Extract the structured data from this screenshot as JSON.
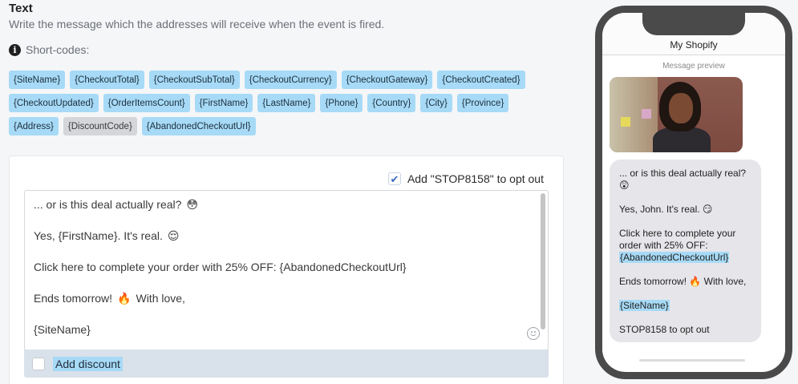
{
  "section": {
    "title": "Text",
    "description": "Write the message which the addresses will receive when the event is fired.",
    "shortcodes_label": "Short-codes:"
  },
  "shortcodes": [
    {
      "label": "{SiteName}",
      "disabled": false
    },
    {
      "label": "{CheckoutTotal}",
      "disabled": false
    },
    {
      "label": "{CheckoutSubTotal}",
      "disabled": false
    },
    {
      "label": "{CheckoutCurrency}",
      "disabled": false
    },
    {
      "label": "{CheckoutGateway}",
      "disabled": false
    },
    {
      "label": "{CheckoutCreated}",
      "disabled": false
    },
    {
      "label": "{CheckoutUpdated}",
      "disabled": false
    },
    {
      "label": "{OrderItemsCount}",
      "disabled": false
    },
    {
      "label": "{FirstName}",
      "disabled": false
    },
    {
      "label": "{LastName}",
      "disabled": false
    },
    {
      "label": "{Phone}",
      "disabled": false
    },
    {
      "label": "{Country}",
      "disabled": false
    },
    {
      "label": "{City}",
      "disabled": false
    },
    {
      "label": "{Province}",
      "disabled": false
    },
    {
      "label": "{Address}",
      "disabled": false
    },
    {
      "label": "{DiscountCode}",
      "disabled": true
    },
    {
      "label": "{AbandonedCheckoutUrl}",
      "disabled": false
    }
  ],
  "editor": {
    "optout_label": "Add \"STOP8158\" to opt out",
    "optout_checked": true,
    "lines": [
      {
        "text": "... or is this deal actually real?",
        "emoji": "😳"
      },
      {
        "text": "Yes, {FirstName}. It's real.",
        "emoji": "😌"
      },
      {
        "text": "Click here to complete your order with 25% OFF: {AbandonedCheckoutUrl}",
        "emoji": ""
      },
      {
        "text": "Ends tomorrow!",
        "emoji": "🔥",
        "after": "With love,"
      },
      {
        "text": "{SiteName}",
        "emoji": ""
      }
    ],
    "add_discount_label": "Add discount"
  },
  "phone": {
    "title": "My Shopify",
    "preview_label": "Message preview",
    "message": {
      "line1": "... or is this deal actually real?",
      "line1_emoji": "😲",
      "line2": "Yes, John. It's real.",
      "line2_emoji": "😏",
      "line3": "Click here to complete your order with 25% OFF:",
      "line3_code": "{AbandonedCheckoutUrl}",
      "line4": "Ends tomorrow!",
      "line4_emoji": "🔥",
      "line4_after": "With love,",
      "line5_code": "{SiteName}",
      "line6": "STOP8158 to opt out"
    }
  },
  "colors": {
    "chip": "#a7daf6",
    "chip_disabled": "#d4d6d9",
    "phone_frame": "#4a4a4a",
    "bubble": "#e6e6ea"
  }
}
